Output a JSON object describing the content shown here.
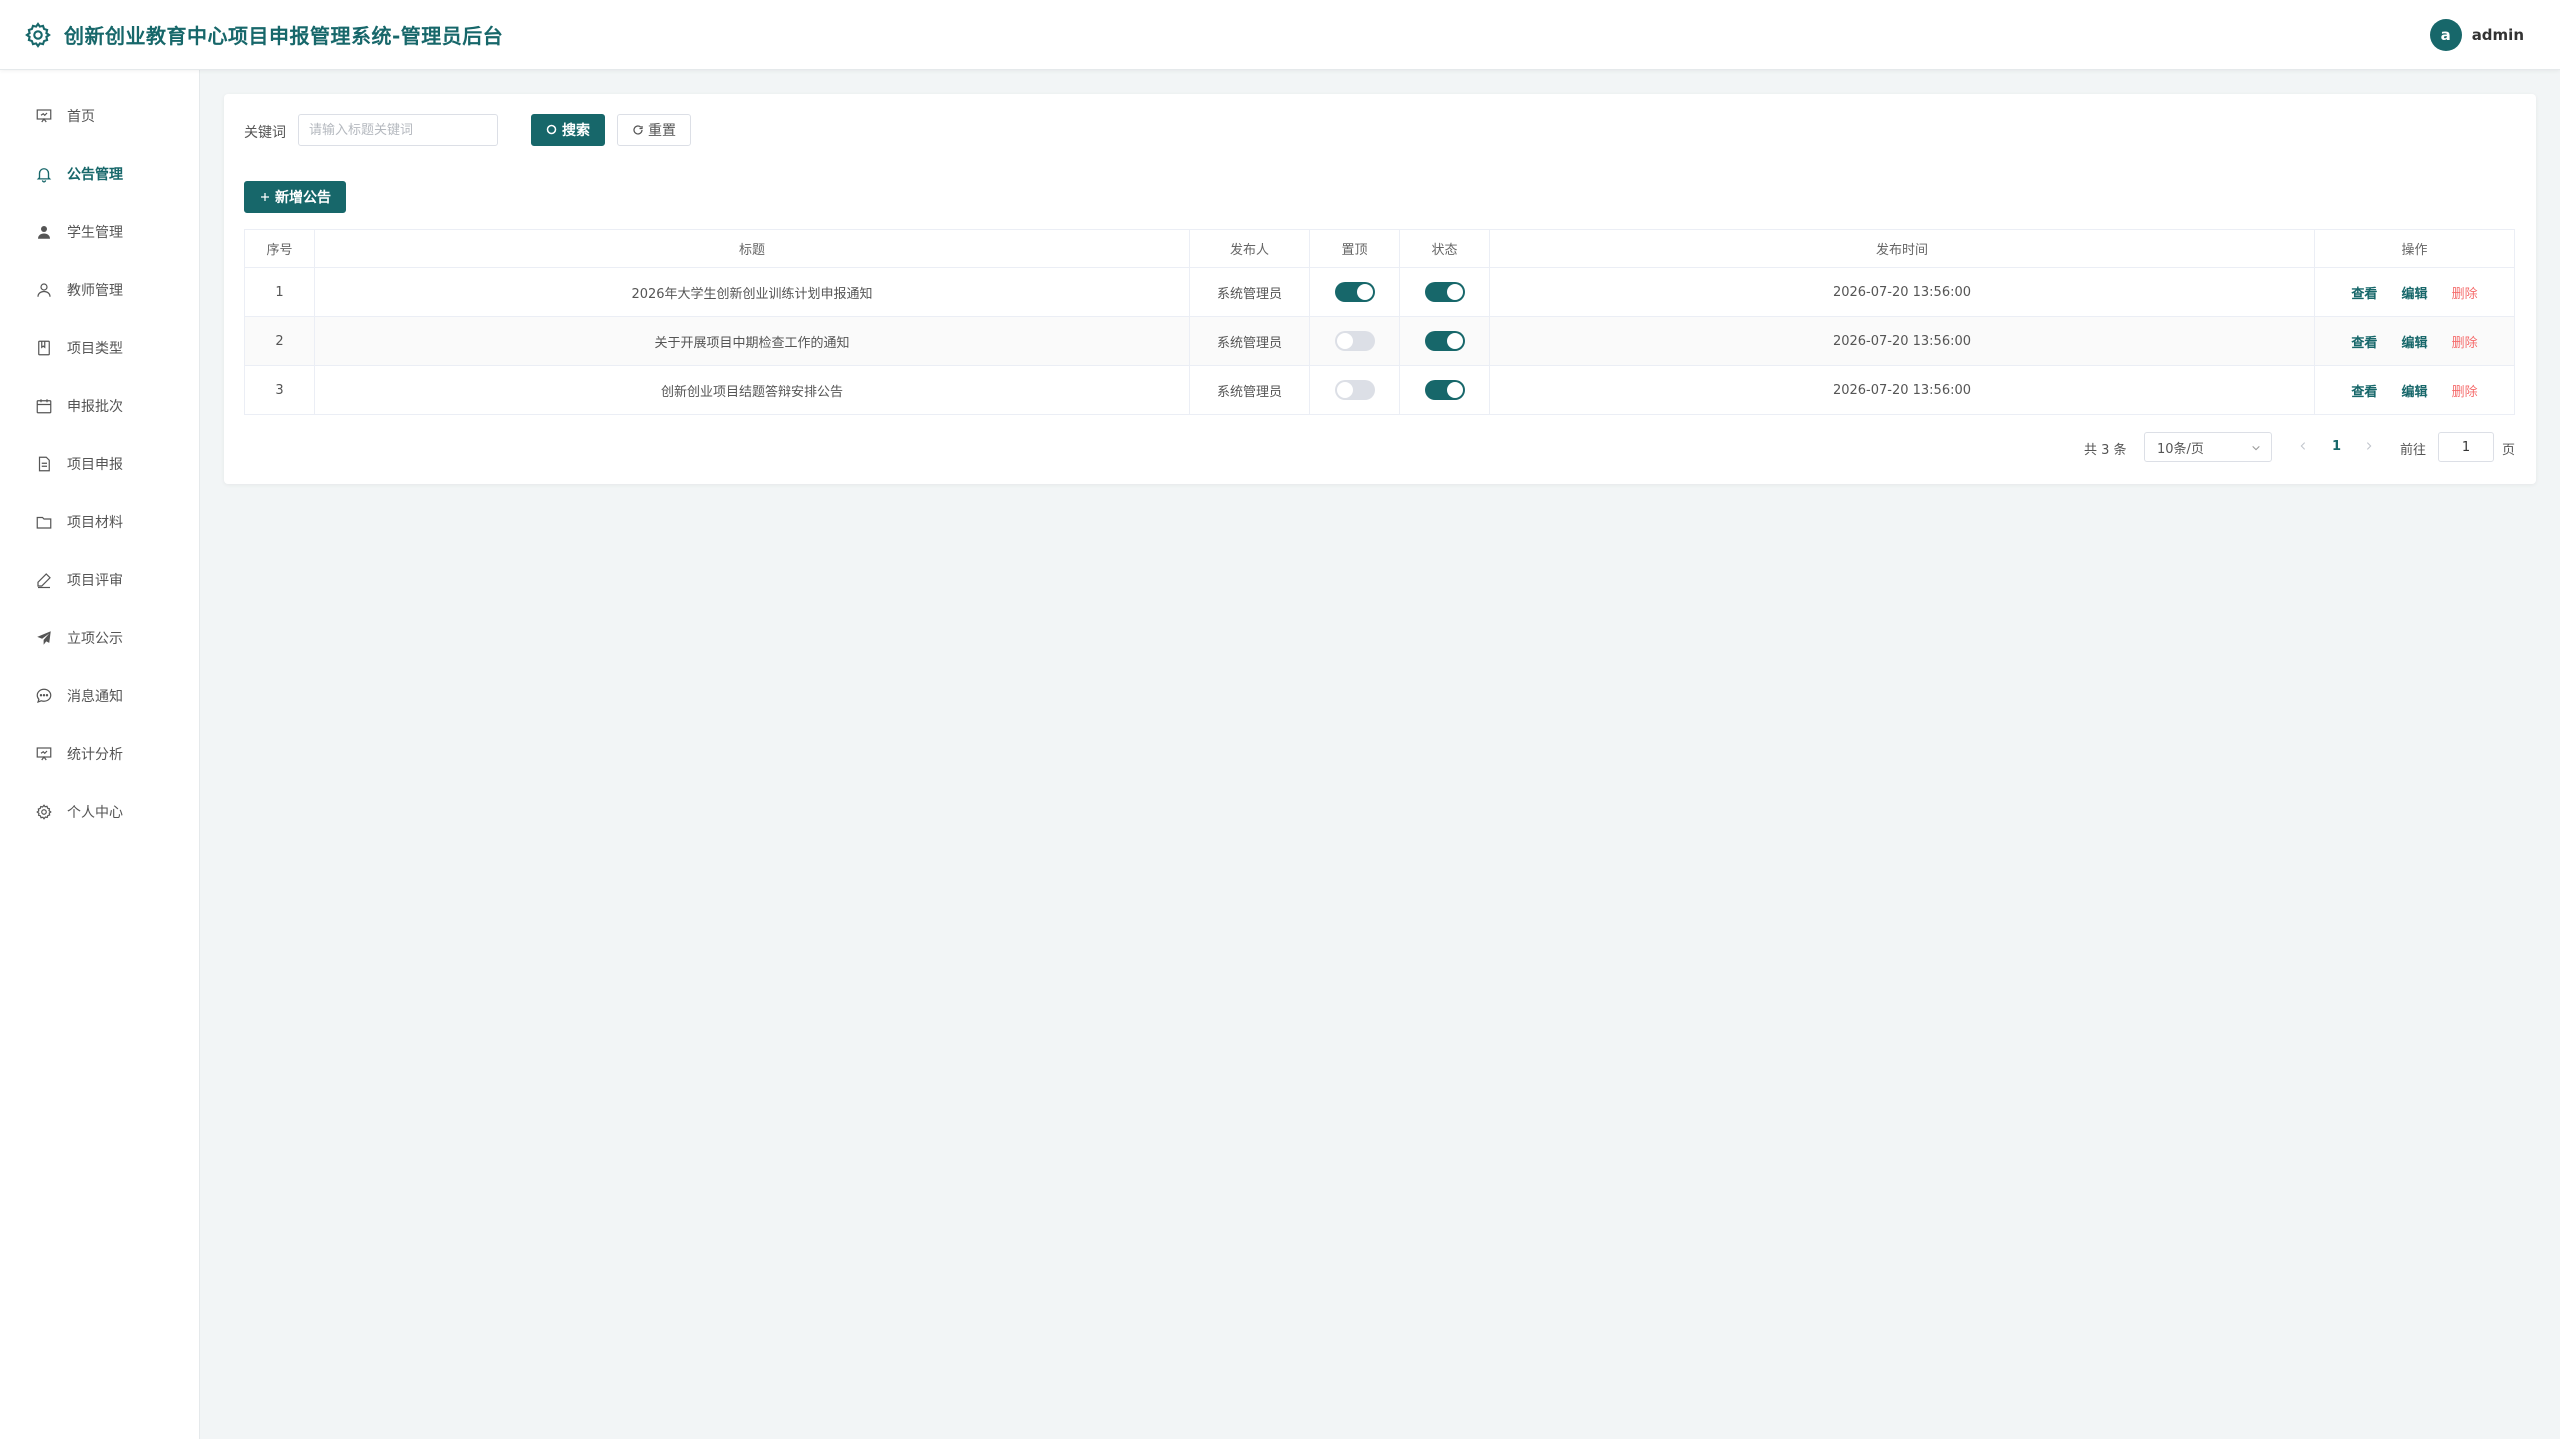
{
  "header": {
    "title": "创新创业教育中心项目申报管理系统-管理员后台",
    "avatar_letter": "a",
    "username": "admin"
  },
  "sidebar": {
    "items": [
      {
        "label": "首页",
        "icon": "presentation-icon"
      },
      {
        "label": "公告管理",
        "icon": "bell-icon",
        "active": true
      },
      {
        "label": "学生管理",
        "icon": "user-filled-icon"
      },
      {
        "label": "教师管理",
        "icon": "user-icon"
      },
      {
        "label": "项目类型",
        "icon": "notebook-icon"
      },
      {
        "label": "申报批次",
        "icon": "calendar-icon"
      },
      {
        "label": "项目申报",
        "icon": "document-icon"
      },
      {
        "label": "项目材料",
        "icon": "folder-icon"
      },
      {
        "label": "项目评审",
        "icon": "edit-pen-icon"
      },
      {
        "label": "立项公示",
        "icon": "promotion-icon"
      },
      {
        "label": "消息通知",
        "icon": "chat-icon"
      },
      {
        "label": "统计分析",
        "icon": "data-board-icon"
      },
      {
        "label": "个人中心",
        "icon": "setting-icon"
      }
    ]
  },
  "search": {
    "label": "关键词",
    "placeholder": "请输入标题关键词",
    "search_button": "搜索",
    "reset_button": "重置"
  },
  "toolbar": {
    "add_button": "新增公告"
  },
  "table": {
    "columns": [
      "序号",
      "标题",
      "发布人",
      "置顶",
      "状态",
      "发布时间",
      "操作"
    ],
    "rows": [
      {
        "index": "1",
        "title": "2026年大学生创新创业训练计划申报通知",
        "publisher": "系统管理员",
        "pinned": true,
        "status": true,
        "time": "2026-07-20 13:56:00"
      },
      {
        "index": "2",
        "title": "关于开展项目中期检查工作的通知",
        "publisher": "系统管理员",
        "pinned": false,
        "status": true,
        "time": "2026-07-20 13:56:00"
      },
      {
        "index": "3",
        "title": "创新创业项目结题答辩安排公告",
        "publisher": "系统管理员",
        "pinned": false,
        "status": true,
        "time": "2026-07-20 13:56:00"
      }
    ],
    "actions": {
      "view": "查看",
      "edit": "编辑",
      "delete": "删除"
    }
  },
  "pagination": {
    "total_text": "共 3 条",
    "page_size": "10条/页",
    "current_page": "1",
    "goto_prefix": "前往",
    "goto_value": "1",
    "goto_suffix": "页"
  },
  "colors": {
    "primary": "#17676a",
    "danger": "#f56c6c",
    "background": "#f2f5f6"
  }
}
